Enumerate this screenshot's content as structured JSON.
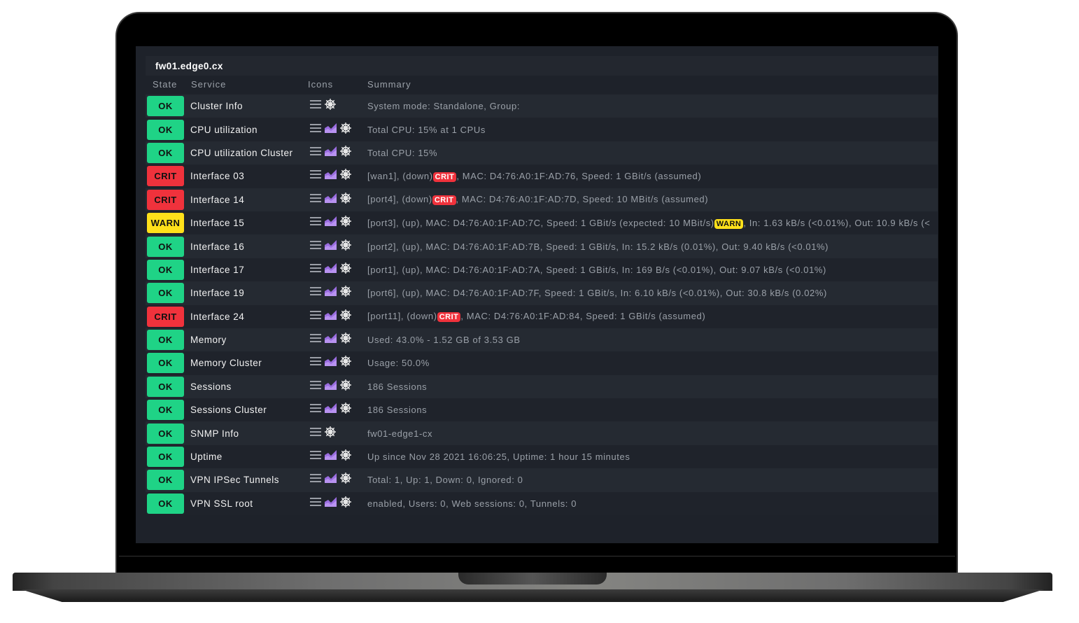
{
  "host": "fw01.edge0.cx",
  "columns": {
    "state": "State",
    "service": "Service",
    "icons": "Icons",
    "summary": "Summary"
  },
  "colors": {
    "OK": "#1fd386",
    "CRIT": "#f0323c",
    "WARN": "#ffe01a",
    "graph": "#9a6de0"
  },
  "rows": [
    {
      "state": "OK",
      "service": "Cluster Info",
      "graph": false,
      "summary": "System mode: Standalone, Group:"
    },
    {
      "state": "OK",
      "service": "CPU utilization",
      "graph": true,
      "summary": "Total CPU: 15% at 1 CPUs"
    },
    {
      "state": "OK",
      "service": "CPU utilization Cluster",
      "graph": true,
      "summary": "Total CPU: 15%"
    },
    {
      "state": "CRIT",
      "service": "Interface 03",
      "graph": true,
      "summary": "[wan1], (down)",
      "badge": "CRIT",
      "summary_post": ", MAC: D4:76:A0:1F:AD:76, Speed: 1 GBit/s (assumed)"
    },
    {
      "state": "CRIT",
      "service": "Interface 14",
      "graph": true,
      "summary": "[port4], (down)",
      "badge": "CRIT",
      "summary_post": ", MAC: D4:76:A0:1F:AD:7D, Speed: 10 MBit/s (assumed)"
    },
    {
      "state": "WARN",
      "service": "Interface 15",
      "graph": true,
      "summary": "[port3], (up), MAC: D4:76:A0:1F:AD:7C, Speed: 1 GBit/s (expected: 10 MBit/s)",
      "badge": "WARN",
      "summary_post": ", In: 1.63 kB/s (<0.01%), Out: 10.9 kB/s (<"
    },
    {
      "state": "OK",
      "service": "Interface 16",
      "graph": true,
      "summary": "[port2], (up), MAC: D4:76:A0:1F:AD:7B, Speed: 1 GBit/s, In: 15.2 kB/s (0.01%), Out: 9.40 kB/s (<0.01%)"
    },
    {
      "state": "OK",
      "service": "Interface 17",
      "graph": true,
      "summary": "[port1], (up), MAC: D4:76:A0:1F:AD:7A, Speed: 1 GBit/s, In: 169 B/s (<0.01%), Out: 9.07 kB/s (<0.01%)"
    },
    {
      "state": "OK",
      "service": "Interface 19",
      "graph": true,
      "summary": "[port6], (up), MAC: D4:76:A0:1F:AD:7F, Speed: 1 GBit/s, In: 6.10 kB/s (<0.01%), Out: 30.8 kB/s (0.02%)"
    },
    {
      "state": "CRIT",
      "service": "Interface 24",
      "graph": true,
      "summary": "[port11], (down)",
      "badge": "CRIT",
      "summary_post": ", MAC: D4:76:A0:1F:AD:84, Speed: 1 GBit/s (assumed)"
    },
    {
      "state": "OK",
      "service": "Memory",
      "graph": true,
      "summary": "Used: 43.0% - 1.52 GB of 3.53 GB"
    },
    {
      "state": "OK",
      "service": "Memory Cluster",
      "graph": true,
      "summary": "Usage: 50.0%"
    },
    {
      "state": "OK",
      "service": "Sessions",
      "graph": true,
      "summary": "186 Sessions"
    },
    {
      "state": "OK",
      "service": "Sessions Cluster",
      "graph": true,
      "summary": "186 Sessions"
    },
    {
      "state": "OK",
      "service": "SNMP Info",
      "graph": false,
      "summary": "fw01-edge1-cx"
    },
    {
      "state": "OK",
      "service": "Uptime",
      "graph": true,
      "summary": "Up since Nov 28 2021 16:06:25, Uptime: 1 hour 15 minutes"
    },
    {
      "state": "OK",
      "service": "VPN IPSec Tunnels",
      "graph": true,
      "summary": "Total: 1, Up: 1, Down: 0, Ignored: 0"
    },
    {
      "state": "OK",
      "service": "VPN SSL root",
      "graph": true,
      "summary": "enabled, Users: 0, Web sessions: 0, Tunnels: 0"
    }
  ]
}
